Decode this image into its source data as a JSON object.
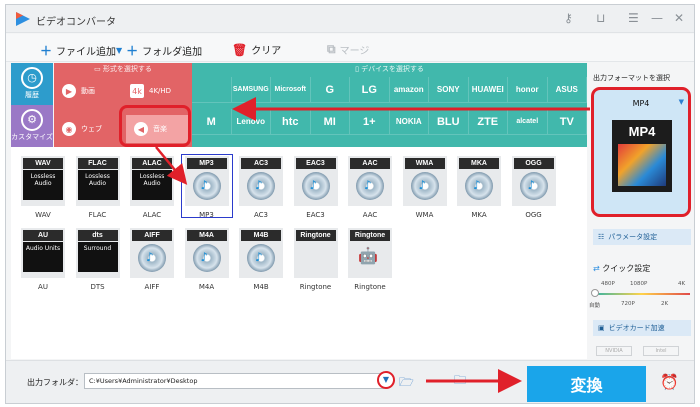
{
  "app_title": "ビデオコンバータ",
  "window_icons": [
    "key-icon",
    "cart-icon",
    "menu-icon",
    "minimize-icon",
    "close-icon"
  ],
  "toolbar": {
    "add_file": "ファイル追加",
    "add_folder": "フォルダ追加",
    "clear": "クリア",
    "merge": "マージ"
  },
  "side": {
    "history": "履歴",
    "customize": "カスタマイズ"
  },
  "format_panel": {
    "header": "形式を選択する",
    "items": [
      "動画",
      "4K/HD",
      "ウェブ",
      "音楽"
    ]
  },
  "device_panel": {
    "header": "デバイスを選択する",
    "row1": [
      "",
      "SAMSUNG",
      "Microsoft",
      "G",
      "LG",
      "amazon",
      "SONY",
      "HUAWEI",
      "honor",
      "ASUS"
    ],
    "row2": [
      "M",
      "Lenovo",
      "htc",
      "MI",
      "1+",
      "NOKIA",
      "BLU",
      "ZTE",
      "alcatel",
      "TV"
    ]
  },
  "audio_formats": [
    {
      "tag": "WAV",
      "sub": "Lossless Audio",
      "label": "WAV"
    },
    {
      "tag": "FLAC",
      "sub": "Lossless Audio",
      "label": "FLAC"
    },
    {
      "tag": "ALAC",
      "sub": "Lossless Audio",
      "label": "ALAC"
    },
    {
      "tag": "MP3",
      "sub": "",
      "label": "MP3"
    },
    {
      "tag": "AC3",
      "sub": "",
      "label": "AC3"
    },
    {
      "tag": "EAC3",
      "sub": "",
      "label": "EAC3"
    },
    {
      "tag": "AAC",
      "sub": "",
      "label": "AAC"
    },
    {
      "tag": "WMA",
      "sub": "",
      "label": "WMA"
    },
    {
      "tag": "MKA",
      "sub": "",
      "label": "MKA"
    },
    {
      "tag": "OGG",
      "sub": "",
      "label": "OGG"
    },
    {
      "tag": "AU",
      "sub": "Audio Units",
      "label": "AU"
    },
    {
      "tag": "dts",
      "sub": "Surround",
      "label": "DTS"
    },
    {
      "tag": "AIFF",
      "sub": "",
      "label": "AIFF"
    },
    {
      "tag": "M4A",
      "sub": "",
      "label": "M4A"
    },
    {
      "tag": "M4B",
      "sub": "",
      "label": "M4B"
    },
    {
      "tag": "Ringtone",
      "sub": "",
      "label": "Ringtone"
    },
    {
      "tag": "Ringtone",
      "sub": "",
      "label": "Ringtone"
    }
  ],
  "selected_format": "MP3",
  "right": {
    "title": "出力フォーマットを選択",
    "format": "MP4",
    "params": "パラメータ設定",
    "quick": "クイック設定",
    "q_top": [
      "480P",
      "1080P",
      "4K"
    ],
    "q_bottom": [
      "自動",
      "720P",
      "2K"
    ],
    "gpu": "ビデオカード加速",
    "vendors": [
      "NVIDIA",
      "Intel"
    ]
  },
  "bottom": {
    "output_folder_label": "出力フォルダ：",
    "output_path": "C:¥Users¥Administrator¥Desktop",
    "convert": "変換"
  },
  "colors": {
    "accent": "#1aa5ea",
    "format_red": "#e26466",
    "device_teal": "#41b8ac",
    "highlight": "#e0202a"
  }
}
